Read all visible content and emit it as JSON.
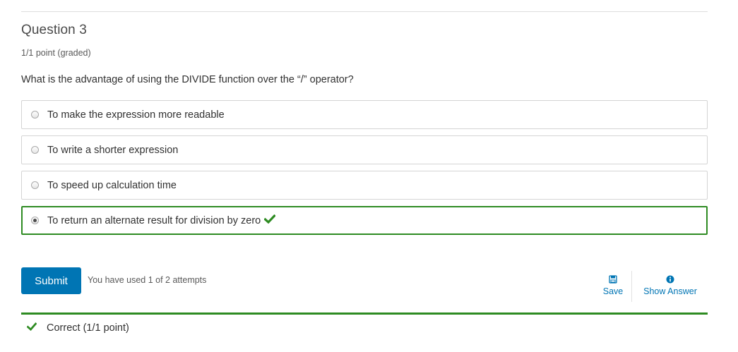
{
  "question": {
    "title": "Question 3",
    "points": "1/1 point (graded)",
    "prompt": "What is the advantage of using the DIVIDE function over the “/” operator?"
  },
  "choices": [
    {
      "label": "To make the expression more readable",
      "selected": false,
      "correct": false
    },
    {
      "label": "To write a shorter expression",
      "selected": false,
      "correct": false
    },
    {
      "label": "To speed up calculation time",
      "selected": false,
      "correct": false
    },
    {
      "label": "To return an alternate result for division by zero",
      "selected": true,
      "correct": true
    }
  ],
  "actions": {
    "submit_label": "Submit",
    "attempts_text": "You have used 1 of 2 attempts",
    "save_label": "Save",
    "show_answer_label": "Show Answer"
  },
  "result": {
    "text": "Correct (1/1 point)"
  },
  "colors": {
    "accent_blue": "#0075b4",
    "correct_green": "#2e8b22"
  },
  "icons": {
    "check": "checkmark-icon",
    "save": "floppy-disk-icon",
    "show_answer": "info-circle-icon"
  }
}
